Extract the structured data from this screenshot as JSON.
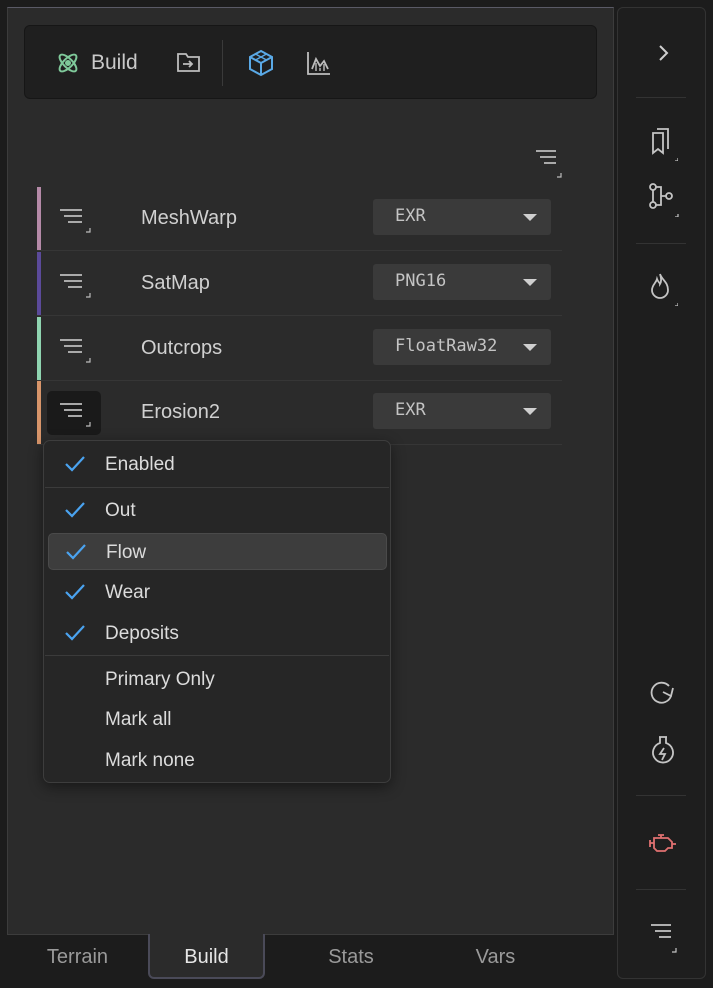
{
  "toolbar": {
    "build_label": "Build",
    "icons": [
      "atom-icon",
      "folder-import-icon",
      "cube-icon",
      "chart-icon"
    ]
  },
  "rows": [
    {
      "name": "MeshWarp",
      "format": "EXR",
      "color": "#b58aa8"
    },
    {
      "name": "SatMap",
      "format": "PNG16",
      "color": "#5b4a9a"
    },
    {
      "name": "Outcrops",
      "format": "FloatRaw32",
      "color": "#8fd4b0"
    },
    {
      "name": "Erosion2",
      "format": "EXR",
      "color": "#d8956a"
    }
  ],
  "dropdown": {
    "items": [
      {
        "label": "Enabled",
        "checked": true
      },
      {
        "label": "Out",
        "checked": true
      },
      {
        "label": "Flow",
        "checked": true
      },
      {
        "label": "Wear",
        "checked": true
      },
      {
        "label": "Deposits",
        "checked": true
      },
      {
        "label": "Primary Only",
        "checked": false
      },
      {
        "label": "Mark all",
        "checked": false
      },
      {
        "label": "Mark none",
        "checked": false
      }
    ]
  },
  "tabs": [
    "Terrain",
    "Build",
    "Stats",
    "Vars"
  ],
  "active_tab": "Build",
  "colors": {
    "check": "#4aa3f0",
    "accent_icon": "#5aa9e6",
    "atom_icon": "#7fc99a",
    "engine_icon": "#e07070"
  }
}
